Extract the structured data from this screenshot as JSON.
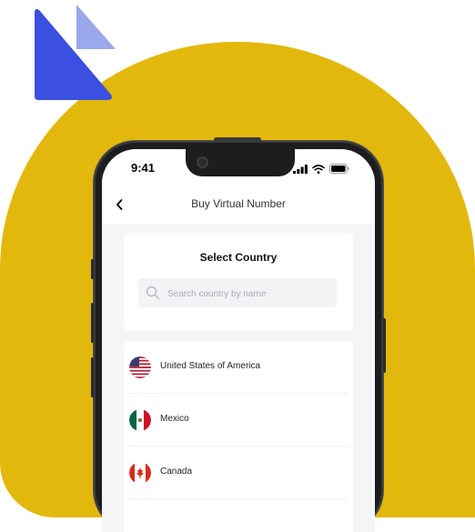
{
  "status_bar": {
    "time": "9:41"
  },
  "header": {
    "title": "Buy Virtual Number",
    "back_icon": "chevron-left-icon"
  },
  "select_card": {
    "title": "Select Country",
    "search": {
      "placeholder": "Search country by name",
      "value": "",
      "icon": "search-icon"
    }
  },
  "countries": [
    {
      "name": "United States of America",
      "flag": "us-flag-icon"
    },
    {
      "name": "Mexico",
      "flag": "mexico-flag-icon"
    },
    {
      "name": "Canada",
      "flag": "canada-flag-icon"
    }
  ],
  "colors": {
    "background_blob": "#e2b80c",
    "logo_primary": "#3b4fe0",
    "logo_secondary": "#9aa7ea",
    "screen_background": "#f4f5f7"
  }
}
